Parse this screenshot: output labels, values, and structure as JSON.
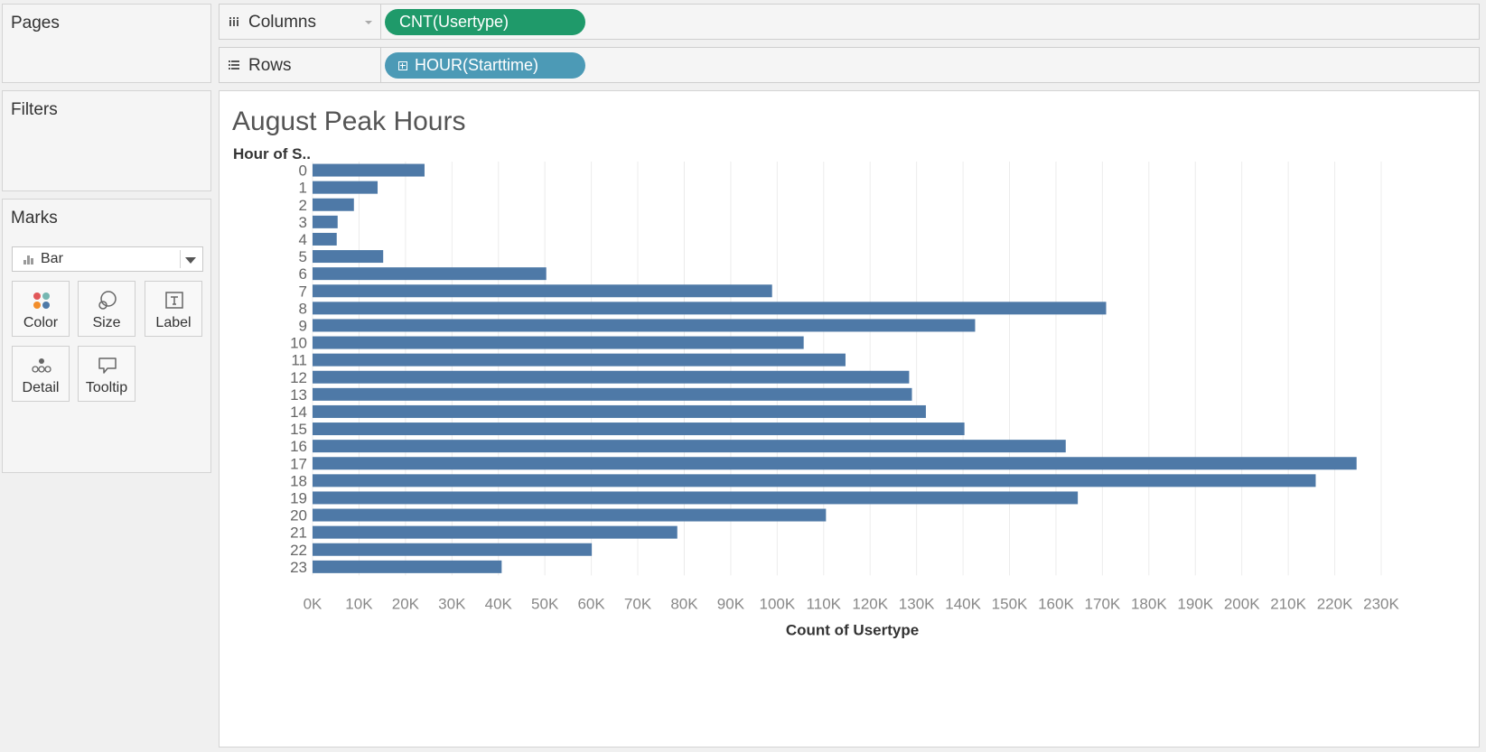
{
  "left_panel": {
    "pages_title": "Pages",
    "filters_title": "Filters",
    "marks_title": "Marks",
    "mark_type": "Bar",
    "mark_buttons": {
      "color": "Color",
      "size": "Size",
      "label": "Label",
      "detail": "Detail",
      "tooltip": "Tooltip"
    }
  },
  "shelves": {
    "columns_label": "Columns",
    "columns_pill": "CNT(Usertype)",
    "rows_label": "Rows",
    "rows_pill": "HOUR(Starttime)"
  },
  "colors": {
    "bar": "#4e79a7",
    "columns_pill": "#1f9a6a",
    "rows_pill": "#4c9ab6"
  },
  "icons": {
    "columns": "columns-shelf-icon",
    "rows": "rows-shelf-icon",
    "mark_type": "bar-chart-icon",
    "color": "color-dots-icon",
    "size": "size-circles-icon",
    "label": "text-label-icon",
    "detail": "detail-dots-icon",
    "tooltip": "speech-bubble-icon"
  },
  "chart_data": {
    "type": "bar",
    "orientation": "horizontal",
    "title": "August Peak Hours",
    "row_header": "Hour of S..",
    "xlabel": "Count of Usertype",
    "categories": [
      "0",
      "1",
      "2",
      "3",
      "4",
      "5",
      "6",
      "7",
      "8",
      "9",
      "10",
      "11",
      "12",
      "13",
      "14",
      "15",
      "16",
      "17",
      "18",
      "19",
      "20",
      "21",
      "22",
      "23"
    ],
    "values": [
      24100,
      14000,
      8900,
      5400,
      5200,
      15200,
      50300,
      98900,
      170800,
      142600,
      105700,
      114700,
      128400,
      129000,
      132000,
      140300,
      162100,
      224700,
      215900,
      164700,
      110500,
      78500,
      60100,
      40700
    ],
    "xlim": [
      0,
      230000
    ],
    "xticks": [
      "0K",
      "10K",
      "20K",
      "30K",
      "40K",
      "50K",
      "60K",
      "70K",
      "80K",
      "90K",
      "100K",
      "110K",
      "120K",
      "130K",
      "140K",
      "150K",
      "160K",
      "170K",
      "180K",
      "190K",
      "200K",
      "210K",
      "220K",
      "230K"
    ],
    "grid": true
  }
}
